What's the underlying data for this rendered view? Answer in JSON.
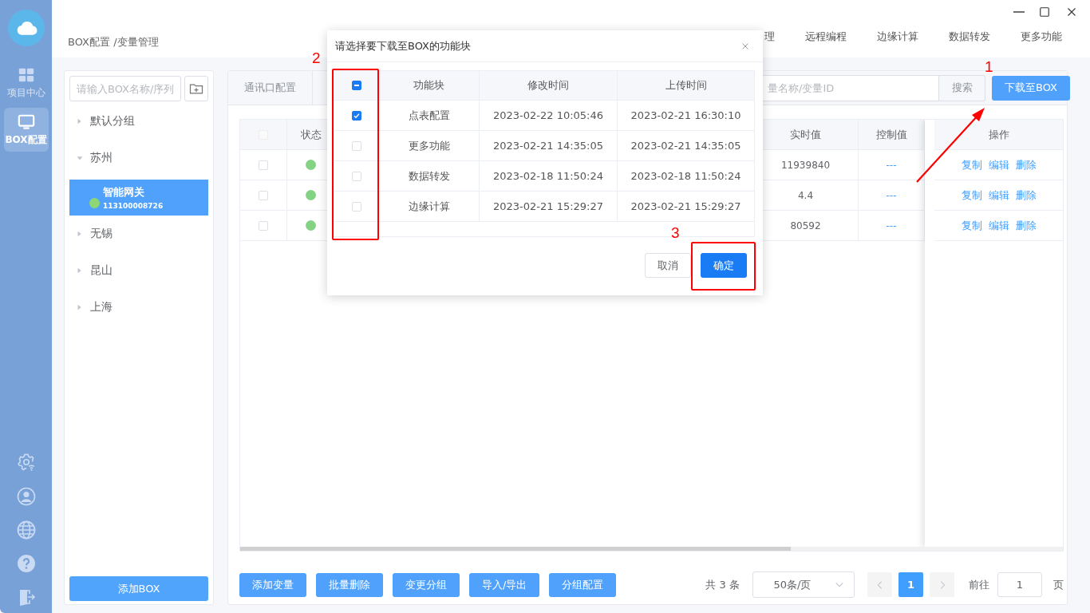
{
  "sidebar": {
    "items": [
      {
        "label": "项目中心",
        "selected": false
      },
      {
        "label": "BOX配置",
        "selected": true
      }
    ]
  },
  "breadcrumb": "BOX配置 /变量管理",
  "top_nav": [
    "理",
    "远程编程",
    "边缘计算",
    "数据转发",
    "更多功能"
  ],
  "tree": {
    "search_placeholder": "请输入BOX名称/序列",
    "groups": [
      {
        "label": "默认分组",
        "expanded": false
      },
      {
        "label": "苏州",
        "expanded": true,
        "children": [
          {
            "name": "智能网关",
            "serial": "113100008726",
            "online": true,
            "selected": true
          }
        ]
      },
      {
        "label": "无锡",
        "expanded": false
      },
      {
        "label": "昆山",
        "expanded": false
      },
      {
        "label": "上海",
        "expanded": false
      }
    ],
    "add_button": "添加BOX"
  },
  "tabs": [
    {
      "label": "通讯口配置",
      "selected": false
    }
  ],
  "search": {
    "placeholder": "量名称/变量ID",
    "button": "搜索"
  },
  "download_button": "下载至BOX",
  "table": {
    "select_all": {
      "checked": false,
      "disabled": true
    },
    "columns": {
      "status": "状态",
      "realtime": "实时值",
      "control": "控制值",
      "actions": "操作"
    },
    "rows": [
      {
        "checked": false,
        "online": true,
        "realtime": "11939840",
        "control": "---",
        "actions": [
          "复制",
          "编辑",
          "删除"
        ]
      },
      {
        "checked": false,
        "online": true,
        "realtime": "4.4",
        "control": "---",
        "actions": [
          "复制",
          "编辑",
          "删除"
        ]
      },
      {
        "checked": false,
        "online": true,
        "realtime": "80592",
        "control": "---",
        "actions": [
          "复制",
          "编辑",
          "删除"
        ]
      }
    ]
  },
  "toolbar_buttons": [
    "添加变量",
    "批量删除",
    "变更分组",
    "导入/导出",
    "分组配置"
  ],
  "pagination": {
    "total": "共 3 条",
    "page_size": "50条/页",
    "pages": [
      {
        "label": "1",
        "selected": true
      }
    ],
    "goto_label": "前往",
    "goto_value": "1",
    "page_unit": "页"
  },
  "dialog": {
    "title": "请选择要下载至BOX的功能块",
    "columns": [
      "功能块",
      "修改时间",
      "上传时间"
    ],
    "select_all": {
      "indeterminate": true
    },
    "rows": [
      {
        "checked": true,
        "name": "点表配置",
        "modified": "2023-02-22 10:05:46",
        "uploaded": "2023-02-21 16:30:10"
      },
      {
        "checked": false,
        "name": "更多功能",
        "modified": "2023-02-21 14:35:05",
        "uploaded": "2023-02-21 14:35:05"
      },
      {
        "checked": false,
        "name": "数据转发",
        "modified": "2023-02-18 11:50:24",
        "uploaded": "2023-02-18 11:50:24"
      },
      {
        "checked": false,
        "name": "边缘计算",
        "modified": "2023-02-21 15:29:27",
        "uploaded": "2023-02-21 15:29:27"
      }
    ],
    "cancel": "取消",
    "confirm": "确定"
  },
  "annotations": {
    "arrow_label": "1",
    "column_label": "2",
    "confirm_label": "3"
  }
}
